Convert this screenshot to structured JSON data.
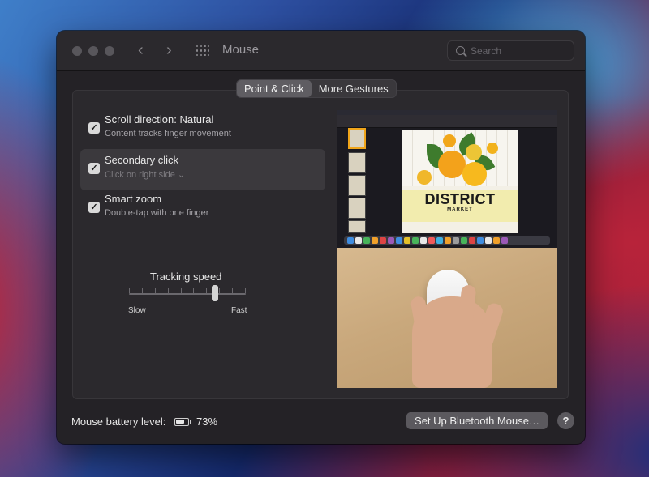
{
  "window": {
    "title": "Mouse",
    "nav_back_glyph": "‹",
    "nav_forward_glyph": "›"
  },
  "search": {
    "placeholder": "Search",
    "value": ""
  },
  "tabs": [
    {
      "label": "Point & Click",
      "active": true
    },
    {
      "label": "More Gestures",
      "active": false
    }
  ],
  "options": [
    {
      "title": "Scroll direction: Natural",
      "subtitle": "Content tracks finger movement",
      "checked": true,
      "selected": false
    },
    {
      "title": "Secondary click",
      "subtitle": "Click on right side ⌄",
      "checked": true,
      "selected": true
    },
    {
      "title": "Smart zoom",
      "subtitle": "Double-tap with one finger",
      "checked": true,
      "selected": false
    }
  ],
  "tracking": {
    "label": "Tracking speed",
    "min_label": "Slow",
    "max_label": "Fast",
    "tick_count": 10,
    "value_fraction": 0.75
  },
  "preview": {
    "slide_title": "DISTRICT",
    "slide_subtitle": "MARKET"
  },
  "footer": {
    "battery_label": "Mouse battery level:",
    "battery_percent": "73%",
    "battery_level": 0.73,
    "bluetooth_button": "Set Up Bluetooth Mouse…",
    "help_glyph": "?"
  },
  "colors": {
    "window_bg": "#242226",
    "active_tab": "#5f5d62",
    "selected_row": "#3b393d",
    "thumb_accent": "#f0a51a"
  }
}
